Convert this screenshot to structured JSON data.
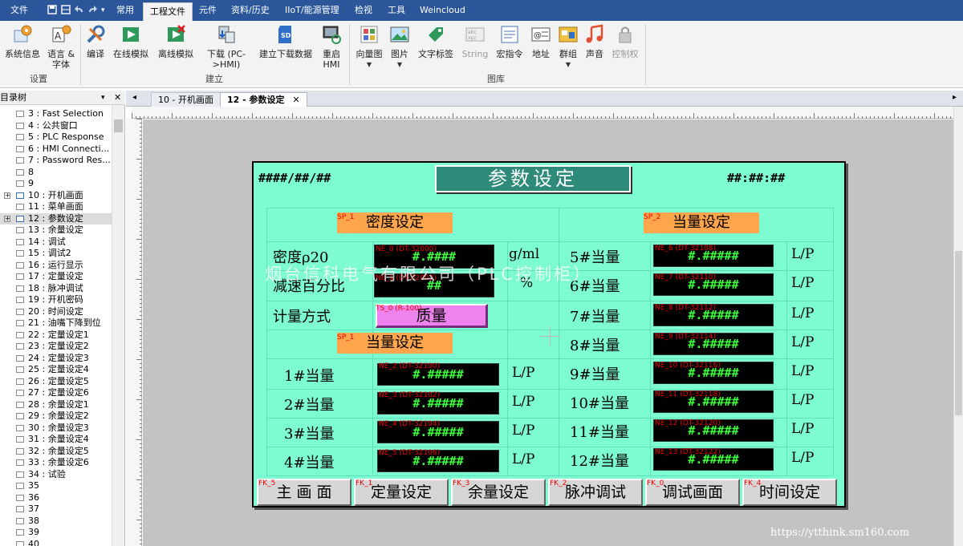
{
  "menu": {
    "file": "文件",
    "common": "常用",
    "project": "工程文件",
    "elements": "元件",
    "data_history": "资料/历史",
    "iiot": "IIoT/能源管理",
    "view": "检视",
    "tools": "工具",
    "weincloud": "Weincloud"
  },
  "ribbon": {
    "system_info": "系统信息",
    "language_font_1": "语言 &",
    "language_font_2": "字体",
    "compile": "编译",
    "online_sim": "在线模拟",
    "offline_sim": "离线模拟",
    "download_1": "下载 (PC-",
    "download_2": ">HMI)",
    "build_download": "建立下载数据",
    "restart_1": "重启",
    "restart_2": "HMI",
    "vector": "向量图",
    "picture": "图片",
    "text_tag": "文字标签",
    "string": "String",
    "macro": "宏指令",
    "address": "地址",
    "group": "群组",
    "sound": "声音",
    "control": "控制权",
    "group_settings": "设置",
    "group_build": "建立",
    "group_library": "图库"
  },
  "tree": {
    "header": "目录树",
    "close": "✕",
    "items": [
      "3 : Fast Selection",
      "4 : 公共窗口",
      "5 : PLC Response",
      "6 : HMI Connecti...",
      "7 : Password Res...",
      "8",
      "9",
      "10 : 开机画面",
      "11 : 菜单画面",
      "12 : 参数设定",
      "13 : 余量设定",
      "14 : 调试",
      "15 : 调试2",
      "16 : 运行显示",
      "17 : 定量设定",
      "18 : 脉冲调试",
      "19 : 开机密码",
      "20 : 时间设定",
      "21 : 油嘴下降到位",
      "22 : 定量设定1",
      "23 : 定量设定2",
      "24 : 定量设定3",
      "25 : 定量设定4",
      "26 : 定量设定5",
      "27 : 定量设定6",
      "28 : 余量设定1",
      "29 : 余量设定2",
      "30 : 余量设定3",
      "31 : 余量设定4",
      "32 : 余量设定5",
      "33 : 余量设定6",
      "34 : 试验",
      "35",
      "36",
      "37",
      "38",
      "39",
      "40"
    ]
  },
  "tabs": {
    "tab1": "10 - 开机画面",
    "tab2": "12 - 参数设定",
    "close": "✕"
  },
  "hmi": {
    "title": "参数设定",
    "header_left": "####/##/##",
    "header_right": "##:##:##",
    "density_title": "密度设定",
    "equiv_title_right": "当量设定",
    "equiv_title_left": "当量设定",
    "density_label": "密度ρ20",
    "decel_label": "减速百分比",
    "metering_label": "计量方式",
    "metering_value": "质量",
    "density_unit": "g/ml",
    "percent_unit": "%",
    "density_value": "#.####",
    "decel_value": "##",
    "equiv_value": "#.#####",
    "unit_lp": "L/P",
    "equiv_left": [
      "1#当量",
      "2#当量",
      "3#当量",
      "4#当量"
    ],
    "equiv_right": [
      "5#当量",
      "6#当量",
      "7#当量",
      "8#当量",
      "9#当量",
      "10#当量",
      "11#当量",
      "12#当量"
    ],
    "tags": {
      "ne0": "NE_0 (DT-32000)",
      "ne1": "NE_1 (DT-32002)",
      "ts0": "TS_0 (R-100)",
      "sp": "SP_1",
      "sp2": "SP_2",
      "ne_left": [
        "NE_2 (DT-32100)",
        "NE_3 (DT-32102)",
        "NE_4 (DT-32104)",
        "NE_5 (DT-32106)"
      ],
      "ne_right": [
        "NE_6 (DT-32108)",
        "NE_7 (DT-32110)",
        "NE_8 (DT-32112)",
        "NE_9 (DT-32114)",
        "NE_10 (DT-32116)",
        "NE_11 (DT-32118)",
        "NE_12 (DT-32120)",
        "NE_13 (DT-32122)"
      ],
      "fk": [
        "FK_5",
        "FK_1",
        "FK_3",
        "FK_2",
        "FK_0",
        "FK_4"
      ]
    },
    "fkeys": [
      "主 画 面",
      "定量设定",
      "余量设定",
      "脉冲调试",
      "调试画面",
      "时间设定"
    ]
  },
  "watermark": "烟台信科电气有限公司（PLC控制柜）",
  "site": "https://ytthink.sm160.com",
  "colors": {
    "menubar": "#2b579a",
    "hmi_bg": "#7cfcd0",
    "title_box": "#2e8b7a",
    "orange": "#ffa64d",
    "numeric_bg": "#000000",
    "numeric_fg": "#3dff3d",
    "toggle": "#ee82ee"
  }
}
